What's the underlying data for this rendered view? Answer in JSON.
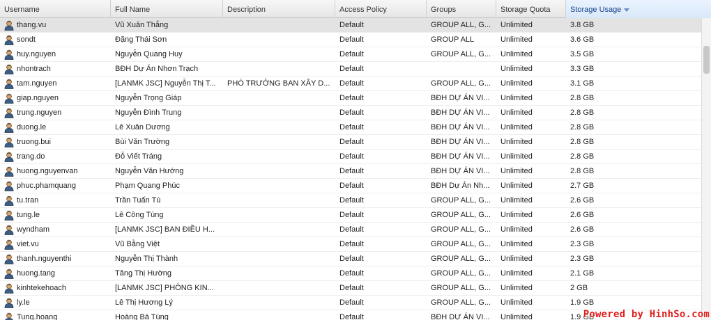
{
  "columns": [
    {
      "key": "username",
      "label": "Username"
    },
    {
      "key": "full_name",
      "label": "Full Name"
    },
    {
      "key": "description",
      "label": "Description"
    },
    {
      "key": "access_policy",
      "label": "Access Policy"
    },
    {
      "key": "groups",
      "label": "Groups"
    },
    {
      "key": "storage_quota",
      "label": "Storage Quota"
    },
    {
      "key": "storage_usage",
      "label": "Storage Usage"
    }
  ],
  "sorted_column": "storage_usage",
  "sort_direction": "descending",
  "selected_row": 0,
  "users": [
    {
      "username": "thang.vu",
      "full_name": "Vũ Xuân Thắng",
      "description": "",
      "access_policy": "Default",
      "groups": "GROUP ALL, G...",
      "storage_quota": "Unlimited",
      "storage_usage": "3.8 GB"
    },
    {
      "username": "sondt",
      "full_name": "Đặng Thái Sơn",
      "description": "",
      "access_policy": "Default",
      "groups": "GROUP ALL",
      "storage_quota": "Unlimited",
      "storage_usage": "3.6 GB"
    },
    {
      "username": "huy.nguyen",
      "full_name": "Nguyễn Quang Huy",
      "description": "",
      "access_policy": "Default",
      "groups": "GROUP ALL, G...",
      "storage_quota": "Unlimited",
      "storage_usage": "3.5 GB"
    },
    {
      "username": "nhontrach",
      "full_name": "BĐH Dự Án Nhơn Trạch",
      "description": "",
      "access_policy": "Default",
      "groups": "",
      "storage_quota": "Unlimited",
      "storage_usage": "3.3 GB"
    },
    {
      "username": "tam.nguyen",
      "full_name": "[LANMK JSC] Nguyễn Thị T...",
      "description": "PHÓ TRƯỞNG BAN XÂY D...",
      "access_policy": "Default",
      "groups": "GROUP ALL, G...",
      "storage_quota": "Unlimited",
      "storage_usage": "3.1 GB"
    },
    {
      "username": "giap.nguyen",
      "full_name": "Nguyễn Trọng Giáp",
      "description": "",
      "access_policy": "Default",
      "groups": "BĐH DỰ ÁN VI...",
      "storage_quota": "Unlimited",
      "storage_usage": "2.8 GB"
    },
    {
      "username": "trung.nguyen",
      "full_name": "Nguyễn Đình Trung",
      "description": "",
      "access_policy": "Default",
      "groups": "BĐH DỰ ÁN VI...",
      "storage_quota": "Unlimited",
      "storage_usage": "2.8 GB"
    },
    {
      "username": "duong.le",
      "full_name": "Lê Xuân Dương",
      "description": "",
      "access_policy": "Default",
      "groups": "BĐH DỰ ÁN VI...",
      "storage_quota": "Unlimited",
      "storage_usage": "2.8 GB"
    },
    {
      "username": "truong.bui",
      "full_name": "Bùi Văn Trường",
      "description": "",
      "access_policy": "Default",
      "groups": "BĐH DỰ ÁN VI...",
      "storage_quota": "Unlimited",
      "storage_usage": "2.8 GB"
    },
    {
      "username": "trang.do",
      "full_name": "Đỗ Viết Tráng",
      "description": "",
      "access_policy": "Default",
      "groups": "BĐH DỰ ÁN VI...",
      "storage_quota": "Unlimited",
      "storage_usage": "2.8 GB"
    },
    {
      "username": "huong.nguyenvan",
      "full_name": "Nguyễn Văn Hướng",
      "description": "",
      "access_policy": "Default",
      "groups": "BĐH DỰ ÁN VI...",
      "storage_quota": "Unlimited",
      "storage_usage": "2.8 GB"
    },
    {
      "username": "phuc.phamquang",
      "full_name": "Phạm Quang Phúc",
      "description": "",
      "access_policy": "Default",
      "groups": "BĐH Dự Án Nh...",
      "storage_quota": "Unlimited",
      "storage_usage": "2.7 GB"
    },
    {
      "username": "tu.tran",
      "full_name": "Trần Tuấn Tú",
      "description": "",
      "access_policy": "Default",
      "groups": "GROUP ALL, G...",
      "storage_quota": "Unlimited",
      "storage_usage": "2.6 GB"
    },
    {
      "username": "tung.le",
      "full_name": "Lê Công Tùng",
      "description": "",
      "access_policy": "Default",
      "groups": "GROUP ALL, G...",
      "storage_quota": "Unlimited",
      "storage_usage": "2.6 GB"
    },
    {
      "username": "wyndham",
      "full_name": "[LANMK JSC] BAN ĐIỀU H...",
      "description": "",
      "access_policy": "Default",
      "groups": "GROUP ALL, G...",
      "storage_quota": "Unlimited",
      "storage_usage": "2.6 GB"
    },
    {
      "username": "viet.vu",
      "full_name": "Vũ Bằng Việt",
      "description": "",
      "access_policy": "Default",
      "groups": "GROUP ALL, G...",
      "storage_quota": "Unlimited",
      "storage_usage": "2.3 GB"
    },
    {
      "username": "thanh.nguyenthi",
      "full_name": "Nguyễn Thị Thành",
      "description": "",
      "access_policy": "Default",
      "groups": "GROUP ALL, G...",
      "storage_quota": "Unlimited",
      "storage_usage": "2.3 GB"
    },
    {
      "username": "huong.tang",
      "full_name": "Tăng Thị Hường",
      "description": "",
      "access_policy": "Default",
      "groups": "GROUP ALL, G...",
      "storage_quota": "Unlimited",
      "storage_usage": "2.1 GB"
    },
    {
      "username": "kinhtekehoach",
      "full_name": "[LANMK JSC] PHÒNG KIN...",
      "description": "",
      "access_policy": "Default",
      "groups": "GROUP ALL, G...",
      "storage_quota": "Unlimited",
      "storage_usage": "2 GB"
    },
    {
      "username": "ly.le",
      "full_name": "Lê Thị Hương Lý",
      "description": "",
      "access_policy": "Default",
      "groups": "GROUP ALL, G...",
      "storage_quota": "Unlimited",
      "storage_usage": "1.9 GB"
    },
    {
      "username": "Tung.hoang",
      "full_name": "Hoàng Bá Tùng",
      "description": "",
      "access_policy": "Default",
      "groups": "BĐH DỰ ÁN VI...",
      "storage_quota": "Unlimited",
      "storage_usage": "1.9 GB"
    }
  ],
  "row_icon": "user-icon",
  "watermark": "Powered by HinhSo.com",
  "colors": {
    "sorted_header_text": "#15428b",
    "selected_row": "#e3e3e3",
    "watermark": "#e0201e"
  }
}
